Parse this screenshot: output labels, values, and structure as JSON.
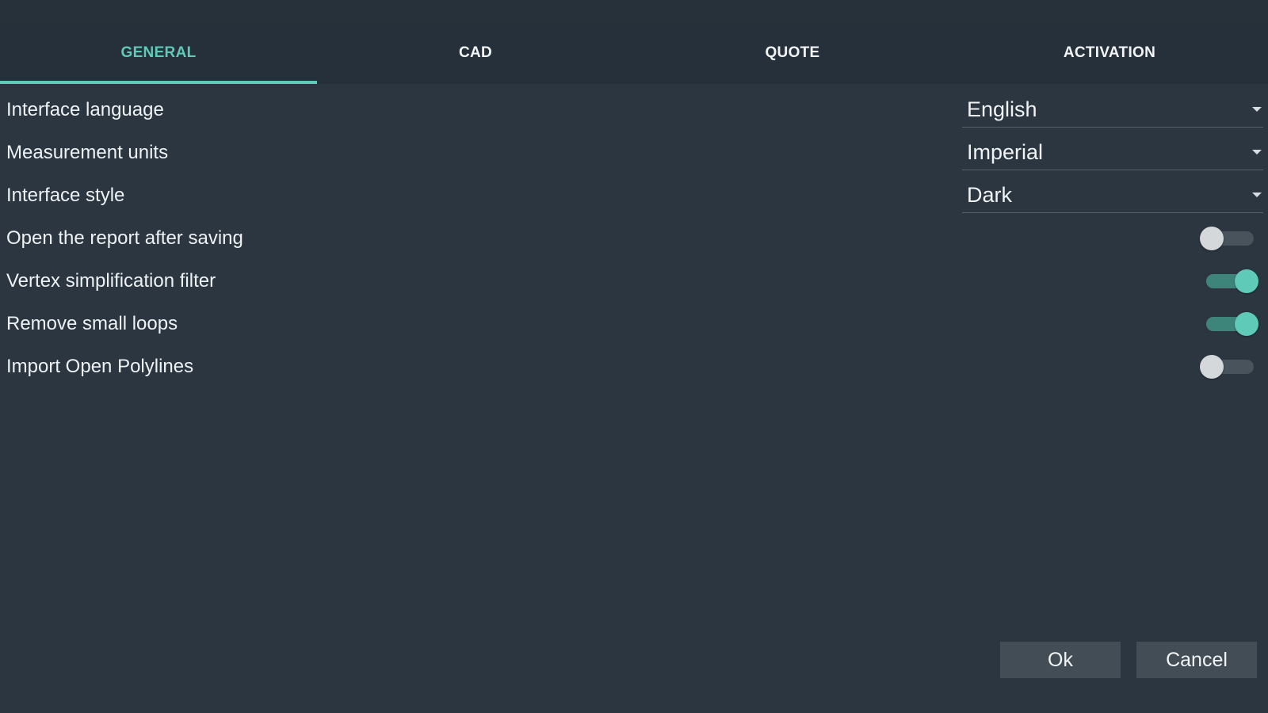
{
  "tabs": [
    {
      "label": "GENERAL",
      "active": true
    },
    {
      "label": "CAD",
      "active": false
    },
    {
      "label": "QUOTE",
      "active": false
    },
    {
      "label": "ACTIVATION",
      "active": false
    }
  ],
  "settings": {
    "interface_language": {
      "label": "Interface language",
      "value": "English"
    },
    "measurement_units": {
      "label": "Measurement units",
      "value": "Imperial"
    },
    "interface_style": {
      "label": "Interface style",
      "value": "Dark"
    },
    "open_report": {
      "label": "Open the report after saving",
      "enabled": false
    },
    "vertex_filter": {
      "label": "Vertex simplification filter",
      "enabled": true
    },
    "remove_loops": {
      "label": "Remove small loops",
      "enabled": true
    },
    "import_polylines": {
      "label": "Import Open Polylines",
      "enabled": false
    }
  },
  "buttons": {
    "ok_label": "Ok",
    "cancel_label": "Cancel"
  },
  "colors": {
    "background": "#2b3640",
    "accent": "#5fcab8",
    "button": "#424d56"
  }
}
